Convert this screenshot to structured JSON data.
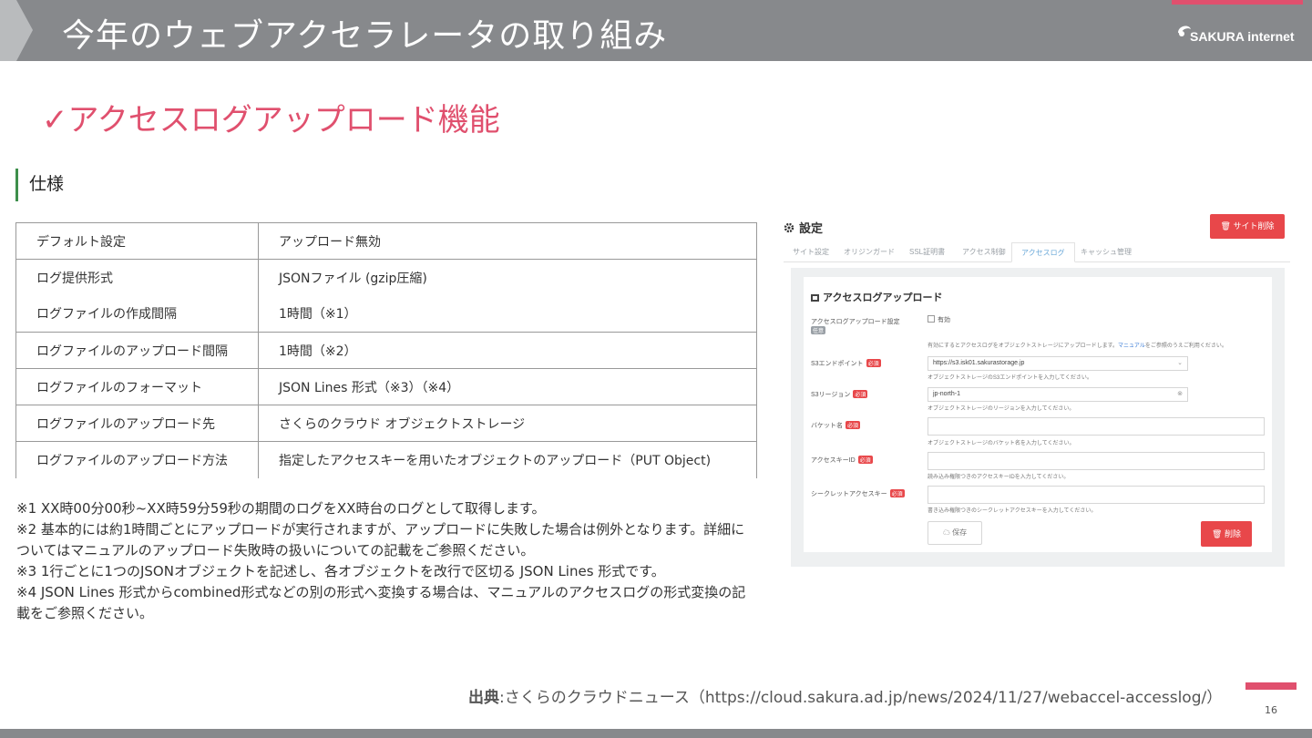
{
  "header": {
    "title": "今年のウェブアクセラレータの取り組み",
    "logo_text": "SAKURA internet"
  },
  "main_heading": "✓アクセスログアップロード機能",
  "spec_heading": "仕様",
  "spec_table": [
    {
      "key": "デフォルト設定",
      "value": "アップロード無効"
    },
    {
      "key": "ログ提供形式",
      "value": "JSONファイル (gzip圧縮)"
    },
    {
      "key": "ログファイルの作成間隔",
      "value": "1時間（※1）"
    },
    {
      "key": "ログファイルのアップロード間隔",
      "value": "1時間（※2）"
    },
    {
      "key": "ログファイルのフォーマット",
      "value": "JSON Lines 形式（※3）（※4）"
    },
    {
      "key": "ログファイルのアップロード先",
      "value": "さくらのクラウド オブジェクトストレージ"
    },
    {
      "key": "ログファイルのアップロード方法",
      "value": "指定したアクセスキーを用いたオブジェクトのアップロード（PUT Object)"
    }
  ],
  "notes": [
    "※1 XX時00分00秒~XX時59分59秒の期間のログをXX時台のログとして取得します。",
    "※2 基本的には約1時間ごとにアップロードが実行されますが、アップロードに失敗した場合は例外となります。詳細についてはマニュアルのアップロード失敗時の扱いについての記載をご参照ください。",
    "※3 1行ごとに1つのJSONオブジェクトを記述し、各オブジェクトを改行で区切る JSON Lines 形式です。",
    "※4 JSON Lines 形式からcombined形式などの別の形式へ変換する場合は、マニュアルのアクセスログの形式変換の記載をご参照ください。"
  ],
  "screenshot": {
    "title": "設定",
    "delete_site_label": "サイト削除",
    "tabs": [
      "サイト設定",
      "オリジンガード",
      "SSL証明書",
      "アクセス制御",
      "アクセスログ",
      "キャッシュ管理"
    ],
    "active_tab_index": 4,
    "card_title": "アクセスログアップロード",
    "upload_setting_label": "アクセスログアップロード設定",
    "optional_badge": "任意",
    "required_badge": "必須",
    "enable_checkbox_label": "有効",
    "enable_help": "有効にするとアクセスログをオブジェクトストレージにアップロードします。",
    "manual_link": "マニュアル",
    "manual_help_tail": "をご参照のうえご利用ください。",
    "endpoint_label": "S3エンドポイント",
    "endpoint_value": "https://s3.isk01.sakurastorage.jp",
    "endpoint_help": "オブジェクトストレージのS3エンドポイントを入力してください。",
    "region_label": "S3リージョン",
    "region_value": "jp-north-1",
    "region_help": "オブジェクトストレージのリージョンを入力してください。",
    "bucket_label": "バケット名",
    "bucket_help": "オブジェクトストレージのバケット名を入力してください。",
    "access_key_label": "アクセスキーID",
    "access_key_help": "読み込み権限つきのアクセスキーIDを入力してください。",
    "secret_label": "シークレットアクセスキー",
    "secret_help": "書き込み権限つきのシークレットアクセスキーを入力してください。",
    "save_label": "保存",
    "delete_label": "削除"
  },
  "source": {
    "label": "出典",
    "text": ":さくらのクラウドニュース（https://cloud.sakura.ad.jp/news/2024/11/27/webaccel-accesslog/）"
  },
  "page_number": "16",
  "colors": {
    "accent": "#e0506e",
    "header_gray": "#87898c",
    "spec_bar_green": "#3e8f4c",
    "button_red": "#e8474a"
  }
}
